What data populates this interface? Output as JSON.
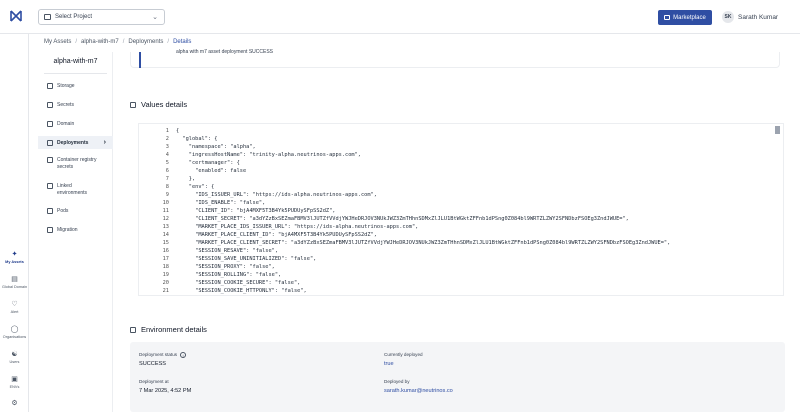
{
  "header": {
    "project_select": "Select Project",
    "marketplace_label": "Marketplace",
    "user_initials": "SK",
    "user_name": "Sarath Kumar"
  },
  "rail": [
    {
      "label": "My Assets",
      "icon": "my-assets-icon"
    },
    {
      "label": "Global Domain",
      "icon": "globe-icon"
    },
    {
      "label": "Alert",
      "icon": "bell-icon"
    },
    {
      "label": "Organisations",
      "icon": "org-icon"
    },
    {
      "label": "Users",
      "icon": "users-icon"
    },
    {
      "label": "ENVs",
      "icon": "env-icon"
    }
  ],
  "breadcrumb": [
    "My Assets",
    "alpha-with-m7",
    "Deployments",
    "Details"
  ],
  "sidepanel": {
    "title": "alpha-with-m7",
    "items": [
      "Storage",
      "Secrets",
      "Domain",
      "Deployments",
      "Container registry secrets",
      "Linked environments",
      "Pods",
      "Migration"
    ]
  },
  "top_card_text": "alpha with m7 asset deployment SUCCESS",
  "values_title": "Values details",
  "code_lines": [
    {
      "n": "1",
      "t": "{"
    },
    {
      "n": "2",
      "t": "  \"global\": {"
    },
    {
      "n": "3",
      "t": "    \"namespace\": \"alpha\","
    },
    {
      "n": "4",
      "t": "    \"ingressHostName\": \"trinity-alpha.neutrinos-apps.com\","
    },
    {
      "n": "5",
      "t": "    \"certmanager\": {"
    },
    {
      "n": "6",
      "t": "      \"enabled\": false"
    },
    {
      "n": "7",
      "t": "    },"
    },
    {
      "n": "8",
      "t": "    \"env\": {"
    },
    {
      "n": "9",
      "t": "      \"IDS_ISSUER_URL\": \"https://ids-alpha.neutrinos-apps.com\","
    },
    {
      "n": "10",
      "t": "      \"IDS_ENABLE\": \"false\","
    },
    {
      "n": "11",
      "t": "      \"CLIENT_ID\": \"bjA4MXF5T3B4Yk5PUDUySFpSS2dZ\","
    },
    {
      "n": "12",
      "t": "      \"CLIENT_SECRET\": \"a3dYZzBxSEZmaFBMV3lJUTZfVVdjYWJHeDRJOV3NUkJWZ3ZmTHhnSDMxZlJLU1BtWGktZFFnb1dPSng0Z084bl9WRTZLZWY2SFNDbzFSOEg3ZndJWUE=\","
    },
    {
      "n": "13",
      "t": "      \"MARKET_PLACE_IDS_ISSUER_URL\": \"https://ids-alpha.neutrinos-apps.com\","
    },
    {
      "n": "14",
      "t": "      \"MARKET_PLACE_CLIENT_ID\": \"bjA4MXF5T3B4Yk5PUDUySFpSS2dZ\","
    },
    {
      "n": "15",
      "t": "      \"MARKET_PLACE_CLIENT_SECRET\": \"a3dYZzBxSEZmaFBMV3lJUTZfVVdjYWJHeDRJOV3NUkJWZ3ZmTHhnSDMxZlJLU1BtWGktZFFnb1dPSng0Z084bl9WRTZLZWY2SFNDbzFSOEg3ZndJWUE=\","
    },
    {
      "n": "16",
      "t": "      \"SESSION_RESAVE\": \"false\","
    },
    {
      "n": "17",
      "t": "      \"SESSION_SAVE_UNINITIALIZED\": \"false\","
    },
    {
      "n": "18",
      "t": "      \"SESSION_PROXY\": \"false\","
    },
    {
      "n": "19",
      "t": "      \"SESSION_ROLLING\": \"false\","
    },
    {
      "n": "20",
      "t": "      \"SESSION_COOKIE_SECURE\": \"false\","
    },
    {
      "n": "21",
      "t": "      \"SESSION_COOKIE_HTTPONLY\": \"false\","
    }
  ],
  "env_title": "Environment details",
  "env": {
    "status_label": "Deployment status",
    "status_value": "SUCCESS",
    "deployed_label": "Currently deployed",
    "deployed_value": "true",
    "deployed_at_label": "Deployment at",
    "deployed_at_value": "7 Mar 2025, 4:52 PM",
    "deployed_by_label": "Deployed by",
    "deployed_by_value": "sarath.kumar@neutrinos.co"
  },
  "colors": {
    "accent": "#2f4ea3",
    "env_bg": "#f4f5f7"
  }
}
